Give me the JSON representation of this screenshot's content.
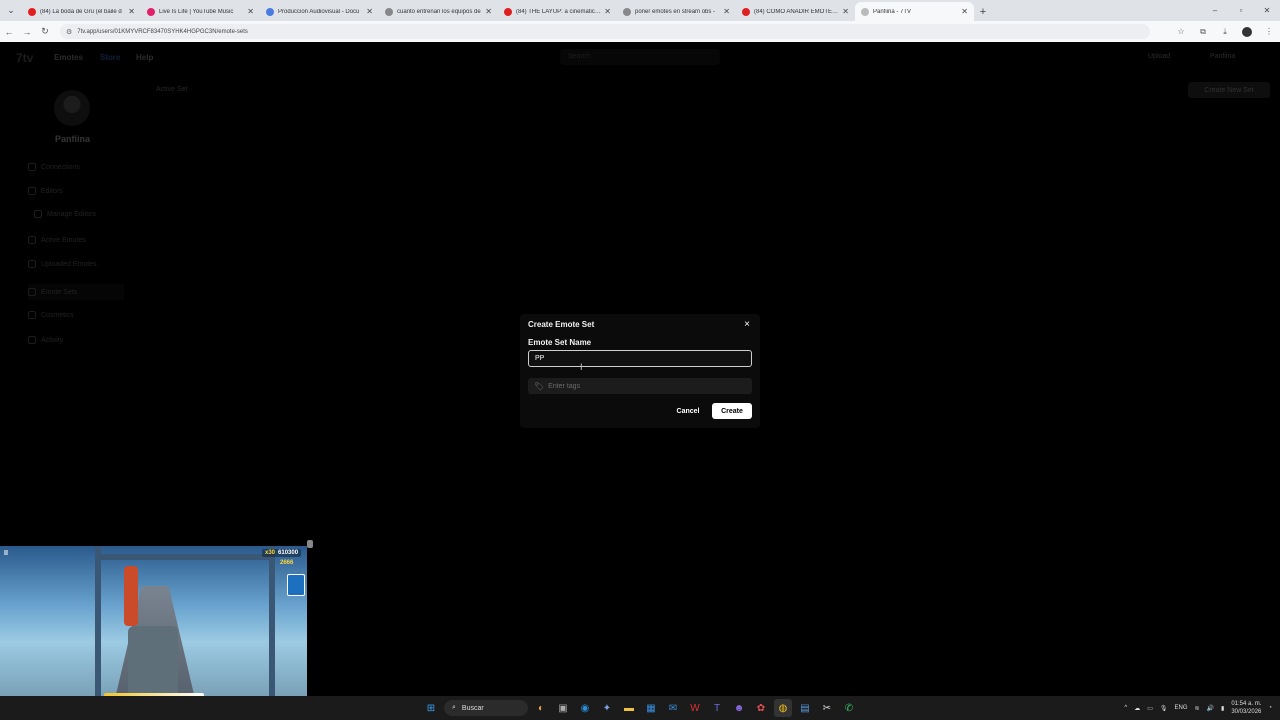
{
  "browser": {
    "tabs": [
      {
        "title": "(84) La boda de Gru (el baile d",
        "color": "#e02020"
      },
      {
        "title": "Live Is Life | YouTube Music",
        "color": "#e0206a"
      },
      {
        "title": "Produccion Audiovisual - Docu",
        "color": "#4a7be0"
      },
      {
        "title": "cuanto entrenan los equipos de",
        "color": "#888888"
      },
      {
        "title": "(84) THE LAYUP: a cinematic ba",
        "color": "#e02020"
      },
      {
        "title": "poner emotes en stream obs -",
        "color": "#888888"
      },
      {
        "title": "(84) COMO AÑADIR EMOTES C",
        "color": "#e02020"
      },
      {
        "title": "Panfiina - 7TV",
        "color": "#bbbbbb"
      }
    ],
    "url": "7tv.app/users/01KMYVRCF83470SYHK4HGPGC3N/emote-sets"
  },
  "app": {
    "logo": "7tv",
    "nav": {
      "emotes": "Emotes",
      "store": "Store",
      "help": "Help"
    },
    "search_placeholder": "Search",
    "upload": "Upload",
    "top_user": "Panfiina",
    "username": "Panfiina",
    "sidebar": [
      {
        "label": "Connections"
      },
      {
        "label": "Editors"
      },
      {
        "label": "Manage Editors"
      },
      {
        "label": "Active Emotes"
      },
      {
        "label": "Uploaded Emotes"
      },
      {
        "label": "Emote Sets"
      },
      {
        "label": "Cosmetics"
      },
      {
        "label": "Activity"
      }
    ],
    "active_set": "Active Set",
    "create_new_set": "Create New Set"
  },
  "modal": {
    "title": "Create Emote Set",
    "close_icon": "×",
    "name_label": "Emote Set Name",
    "name_value": "PP",
    "tags_placeholder": "Enter tags",
    "cancel": "Cancel",
    "create": "Create"
  },
  "video": {
    "multiplier": "x30",
    "score": "610300",
    "coins": "2666"
  },
  "taskbar": {
    "search": "Buscar",
    "lang": "ENG",
    "time": "01:54 a. m.",
    "date": "30/03/2026"
  }
}
